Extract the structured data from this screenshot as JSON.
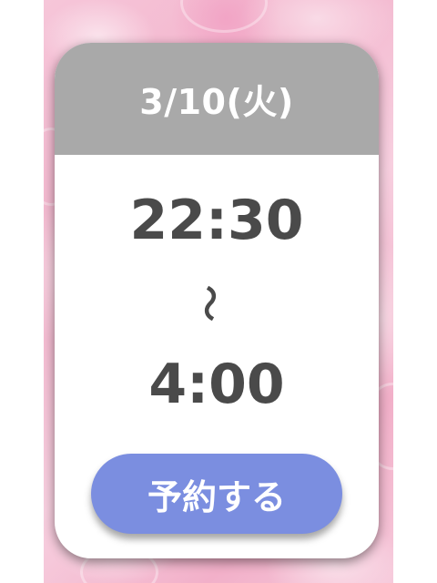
{
  "schedule_card": {
    "date": "3/10(火)",
    "start_time": "22:30",
    "separator": "〜",
    "end_time": "4:00",
    "reserve_label": "予約する"
  },
  "colors": {
    "header_bg": "#a9a9a9",
    "button_bg": "#7b8ee0",
    "time_text": "#4a4a4a",
    "background_pink": "#f3b5cd"
  }
}
